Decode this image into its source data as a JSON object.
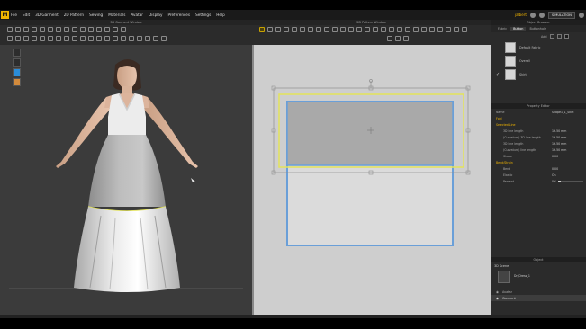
{
  "menubar": {
    "items": [
      "File",
      "Edit",
      "3D Garment",
      "2D Pattern",
      "Sewing",
      "Materials",
      "Avatar",
      "Display",
      "Preferences",
      "Settings",
      "Help"
    ],
    "user": "jalbert",
    "mode": "SIMULATION"
  },
  "windows": {
    "left_title": "3D Garment Window",
    "mid_title": "2D Pattern Window"
  },
  "object_browser_top": {
    "title": "Object Browser",
    "tabs": [
      "Fabric",
      "Button",
      "Buttonhole"
    ],
    "active_tab": "Fabric",
    "add_label": "Add",
    "fabrics": [
      {
        "name": "Default Fabric",
        "checked": false
      },
      {
        "name": "Overall",
        "checked": false
      },
      {
        "name": "Skirt",
        "checked": true
      }
    ]
  },
  "property_editor": {
    "title": "Property Editor",
    "rows": [
      {
        "label": "Name",
        "value": "Shape1_1_Skirt",
        "kind": "row"
      },
      {
        "label": "Fold",
        "value": "",
        "kind": "section"
      },
      {
        "label": "Selected Line",
        "value": "",
        "kind": "section"
      },
      {
        "label": "3D line length",
        "value": "19.50 mm",
        "kind": "sub"
      },
      {
        "label": "(Curvature) 3D line length",
        "value": "19.50 mm",
        "kind": "sub"
      },
      {
        "label": "3D line length",
        "value": "19.50 mm",
        "kind": "sub"
      },
      {
        "label": "(Curvature) line length",
        "value": "19.50 mm",
        "kind": "sub"
      },
      {
        "label": "Shape",
        "value": "0.00",
        "kind": "sub"
      },
      {
        "label": "Bend/Strain",
        "value": "",
        "kind": "section"
      },
      {
        "label": "Bend",
        "value": "0.00",
        "kind": "sub"
      },
      {
        "label": "Elastic",
        "value": "On",
        "kind": "sub"
      },
      {
        "label": "Percent",
        "value": "0%",
        "kind": "sub"
      }
    ]
  },
  "object_browser_bottom": {
    "title": "Object",
    "section": "3D Scene",
    "thumb_name": "Dr_Dress_1",
    "layers": [
      {
        "name": "Avatar",
        "selected": false
      },
      {
        "name": "Garment",
        "selected": true
      }
    ]
  },
  "colors": {
    "accent": "#f0b400",
    "pattern_blue": "#6a9fd8",
    "pattern_yellow": "#e3e35a",
    "pattern_fill": "#a9a9a9",
    "canvas_2d": "#cecece",
    "canvas_3d": "#3b3b3b"
  }
}
